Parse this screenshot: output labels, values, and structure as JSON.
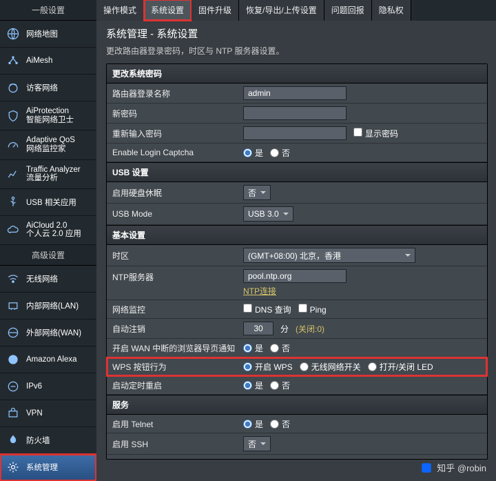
{
  "sidebar": {
    "generalHeader": "一般设置",
    "advancedHeader": "高级设置",
    "general": [
      {
        "label": "网络地图"
      },
      {
        "label": "AiMesh"
      },
      {
        "label": "访客网络"
      },
      {
        "label": "AiProtection\n智能网络卫士"
      },
      {
        "label": "Adaptive QoS\n网络监控家"
      },
      {
        "label": "Traffic Analyzer\n流量分析"
      },
      {
        "label": "USB 相关应用"
      },
      {
        "label": "AiCloud 2.0\n个人云 2.0 应用"
      }
    ],
    "advanced": [
      {
        "label": "无线网络"
      },
      {
        "label": "内部网络(LAN)"
      },
      {
        "label": "外部网络(WAN)"
      },
      {
        "label": "Amazon Alexa"
      },
      {
        "label": "IPv6"
      },
      {
        "label": "VPN"
      },
      {
        "label": "防火墙"
      },
      {
        "label": "系统管理"
      }
    ]
  },
  "tabs": [
    "操作模式",
    "系统设置",
    "固件升级",
    "恢复/导出/上传设置",
    "问题回报",
    "隐私权"
  ],
  "page": {
    "title": "系统管理 - 系统设置",
    "desc": "更改路由器登录密码，时区与 NTP 服务器设置。"
  },
  "sections": {
    "pw": {
      "header": "更改系统密码",
      "loginName": {
        "k": "路由器登录名称",
        "v": "admin"
      },
      "newPw": {
        "k": "新密码"
      },
      "rePw": {
        "k": "重新输入密码",
        "show": "显示密码"
      },
      "captcha": {
        "k": "Enable Login Captcha",
        "yes": "是",
        "no": "否"
      }
    },
    "usb": {
      "header": "USB 设置",
      "hdd": {
        "k": "启用硬盘休眠",
        "v": "否"
      },
      "mode": {
        "k": "USB Mode",
        "v": "USB 3.0"
      }
    },
    "basic": {
      "header": "基本设置",
      "tz": {
        "k": "时区",
        "v": "(GMT+08:00) 北京，香港"
      },
      "ntp": {
        "k": "NTP服务器",
        "v": "pool.ntp.org",
        "link": "NTP连接"
      },
      "mon": {
        "k": "网络监控",
        "dns": "DNS 查询",
        "ping": "Ping"
      },
      "logout": {
        "k": "自动注销",
        "v": "30",
        "unit": "分",
        "note": "(关闭:0)"
      },
      "redirect": {
        "k": "开启 WAN 中断的浏览器导页通知",
        "yes": "是",
        "no": "否"
      },
      "wps": {
        "k": "WPS 按钮行为",
        "a": "开启 WPS",
        "b": "无线网络开关",
        "c": "打开/关闭 LED"
      },
      "sched": {
        "k": "启动定时重启",
        "yes": "是",
        "no": "否"
      }
    },
    "svc": {
      "header": "服务",
      "telnet": {
        "k": "启用 Telnet",
        "yes": "是",
        "no": "否"
      },
      "ssh": {
        "k": "启用 SSH",
        "v": "否"
      }
    }
  },
  "watermark": "知乎 @robin"
}
